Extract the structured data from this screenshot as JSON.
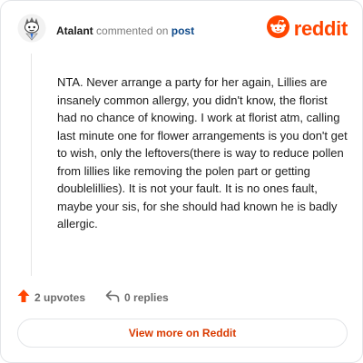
{
  "colors": {
    "reddit_orange": "#ff4500",
    "link_blue": "#0f4a8a",
    "button_text": "#d93a00",
    "muted_text": "#6c6c6c"
  },
  "header": {
    "avatar_icon": "snoo-avatar-icon",
    "username": "Atalant",
    "action_text": "commented on",
    "post_link": "post",
    "logo_icon": "reddit-snoo-icon",
    "logo_text": "reddit"
  },
  "comment": {
    "text": "NTA. Never arrange a party for her again, Lillies are insanely common allergy, you didn't know, the florist had no chance of knowing. I work at florist atm, calling last minute one for flower arrangements is you don't get to wish, only the leftovers(there is way to reduce pollen from lillies like removing the polen part or getting doublelillies). It is not your fault. It is no ones fault, maybe your sis, for she should had known he is badly allergic."
  },
  "actions": {
    "upvote_icon": "upvote-arrow-icon",
    "upvotes": "2 upvotes",
    "reply_icon": "reply-arrow-icon",
    "replies": "0 replies"
  },
  "footer": {
    "view_button": "View more on Reddit"
  }
}
